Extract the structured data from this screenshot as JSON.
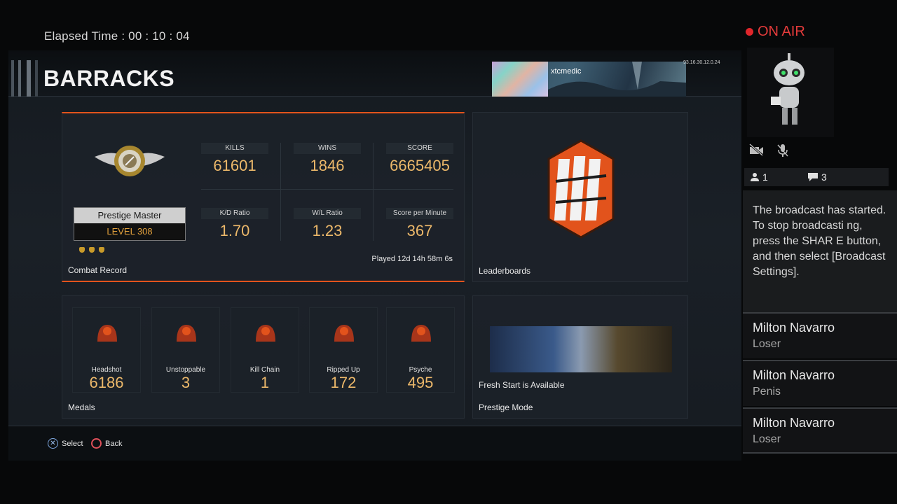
{
  "stream": {
    "elapsed_label": "Elapsed Time : 00 : 10 : 04",
    "onair_label": "ON AIR",
    "viewers": "1",
    "comments": "3",
    "system_message": "The broadcast has started.\nTo stop broadcasti ng, press the SHAR E button, and then select [Broadcast Settings].",
    "chat": [
      {
        "name": "Milton Navarro",
        "text": "Loser"
      },
      {
        "name": "Milton Navarro",
        "text": "Penis"
      },
      {
        "name": "Milton Navarro",
        "text": "Loser"
      }
    ]
  },
  "game": {
    "title": "BARRACKS",
    "gamertag": "xtcmedic",
    "ip": "93.16.30.12.0.24",
    "combat": {
      "label": "Combat Record",
      "prestige_name": "Prestige Master",
      "level": "LEVEL 308",
      "stats": [
        {
          "label": "KILLS",
          "value": "61601"
        },
        {
          "label": "WINS",
          "value": "1846"
        },
        {
          "label": "SCORE",
          "value": "6665405"
        },
        {
          "label": "K/D Ratio",
          "value": "1.70"
        },
        {
          "label": "W/L Ratio",
          "value": "1.23"
        },
        {
          "label": "Score per Minute",
          "value": "367"
        }
      ],
      "played": "Played 12d 14h 58m 6s"
    },
    "leaderboards_label": "Leaderboards",
    "medals": {
      "label": "Medals",
      "items": [
        {
          "name": "Headshot",
          "value": "6186"
        },
        {
          "name": "Unstoppable",
          "value": "3"
        },
        {
          "name": "Kill Chain",
          "value": "1"
        },
        {
          "name": "Ripped Up",
          "value": "172"
        },
        {
          "name": "Psyche",
          "value": "495"
        }
      ]
    },
    "prestige_mode": {
      "title": "Fresh Start is Available",
      "label": "Prestige Mode"
    },
    "footer": {
      "select_label": "Select",
      "back_label": "Back"
    }
  },
  "colors": {
    "accent": "#e2531c",
    "stat_value": "#ecb86a",
    "onair": "#e43b3b"
  }
}
